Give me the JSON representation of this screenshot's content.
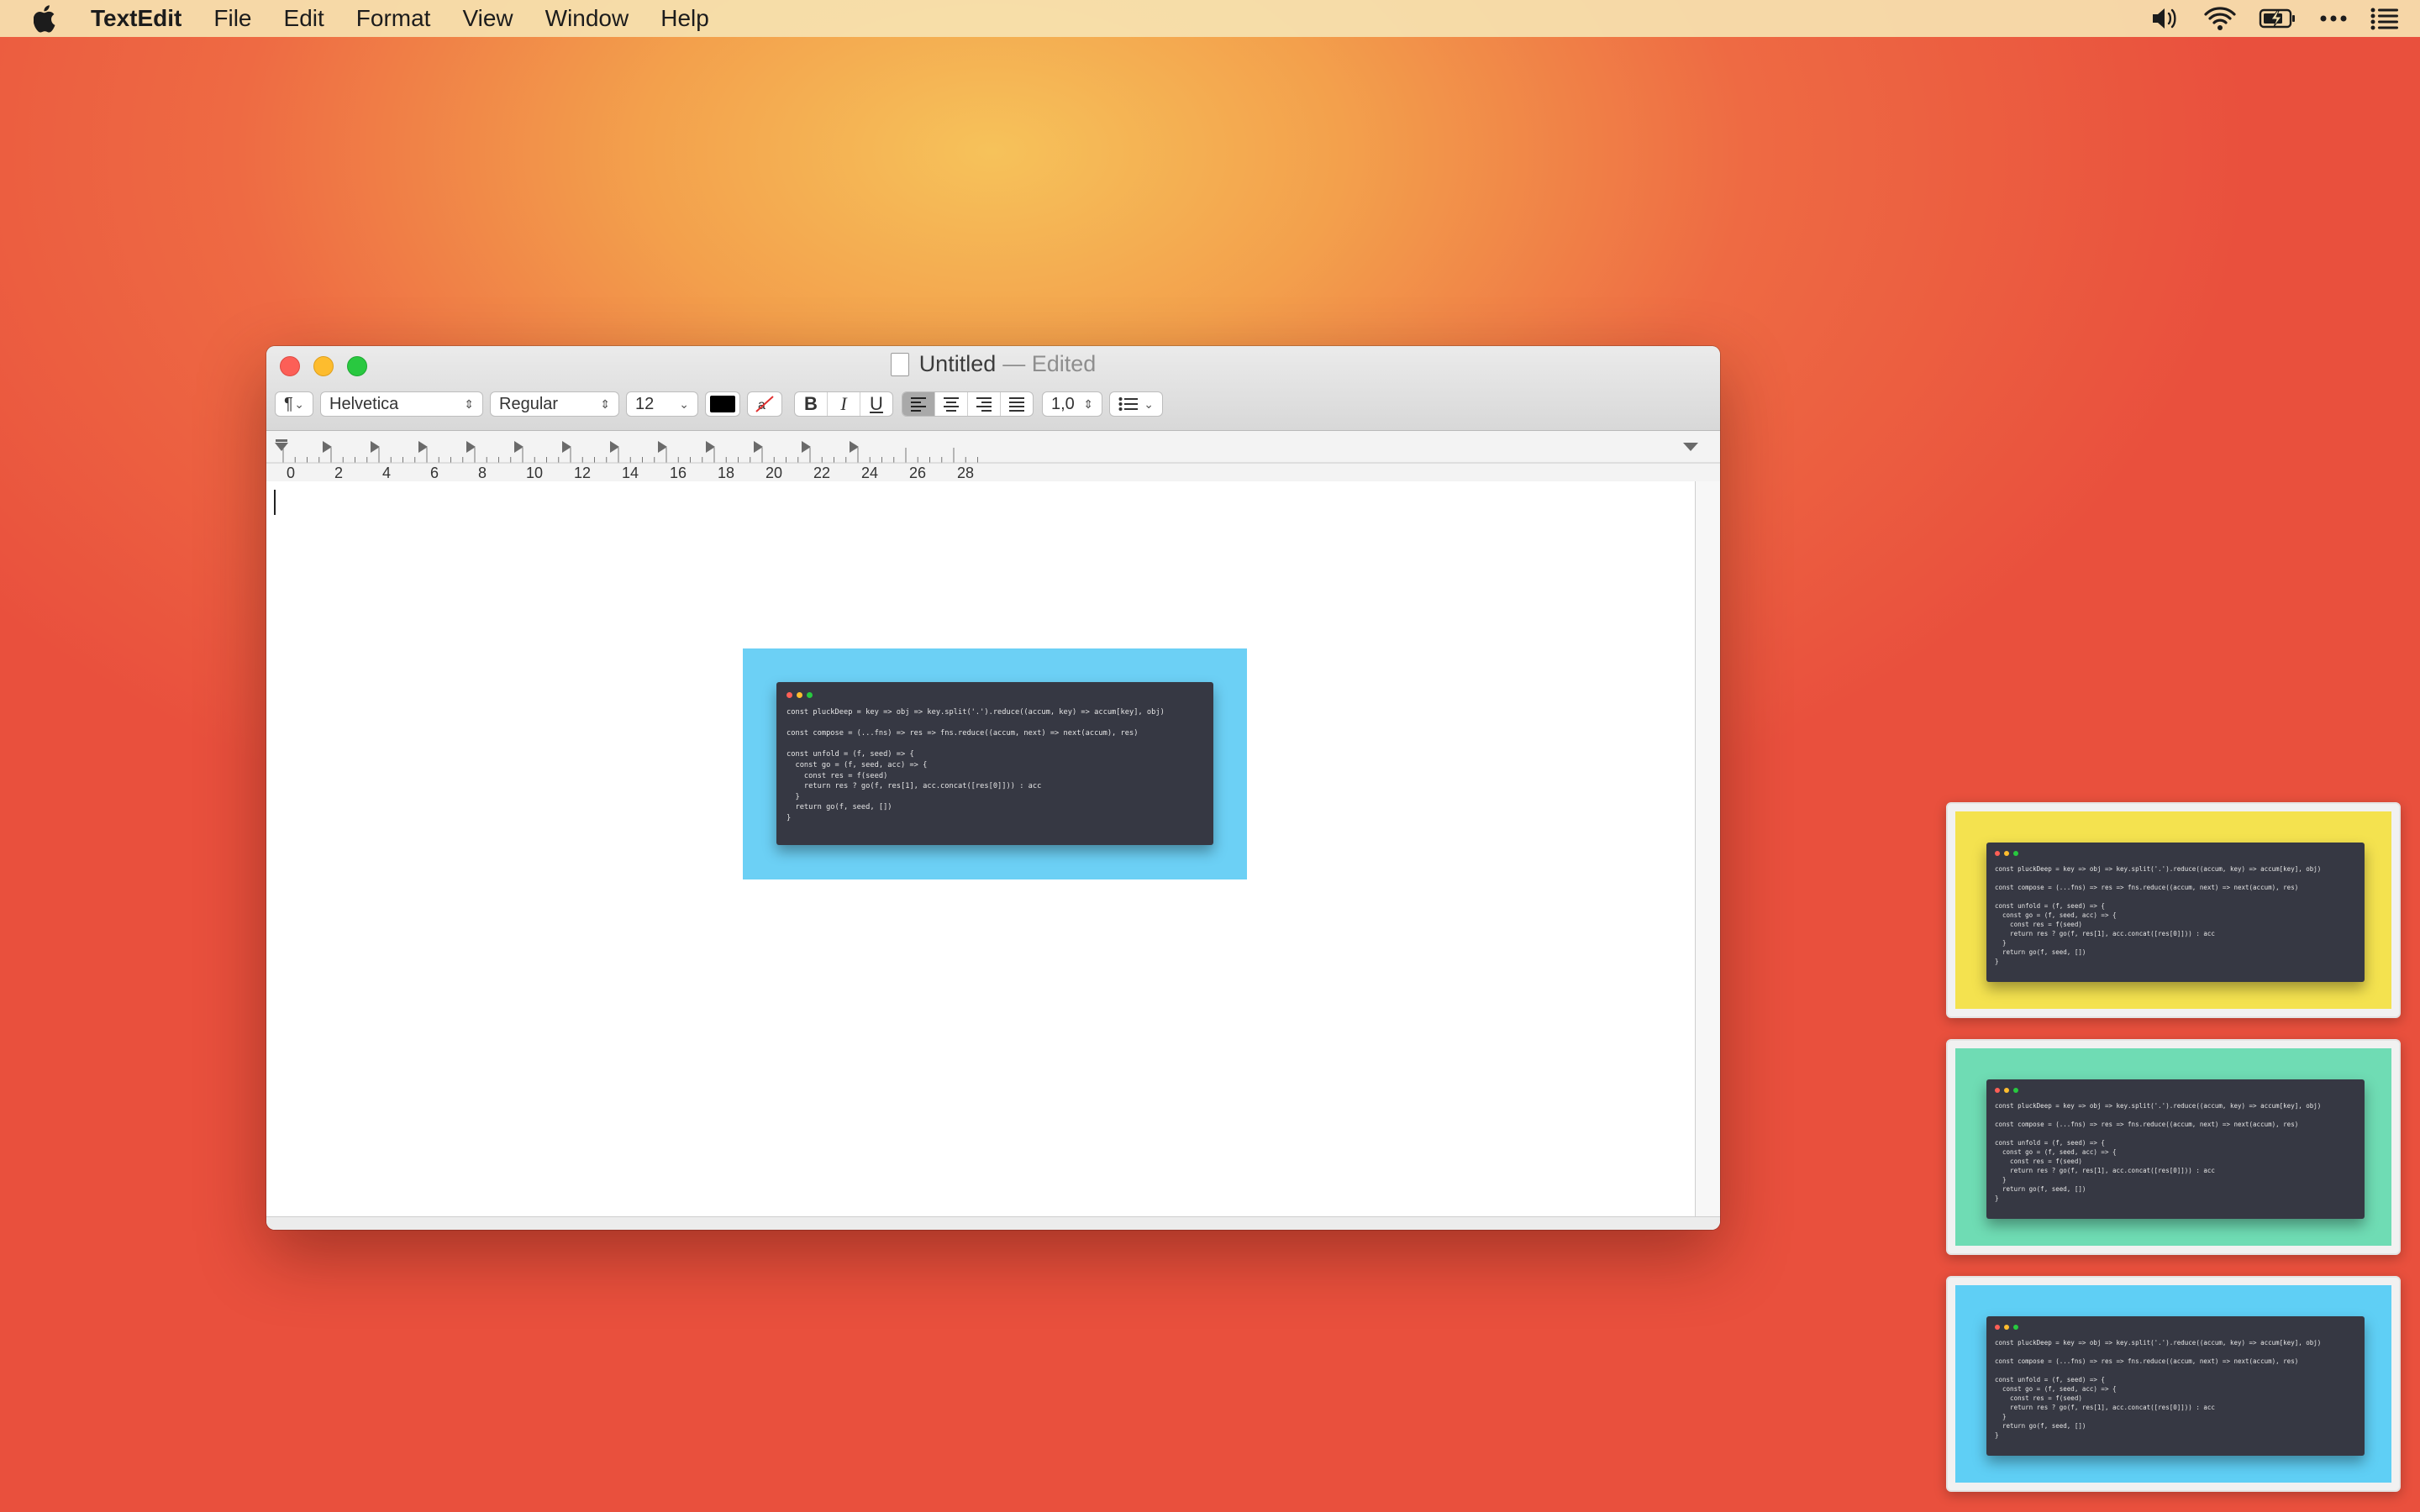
{
  "menubar": {
    "app_name": "TextEdit",
    "items": [
      "File",
      "Edit",
      "Format",
      "View",
      "Window",
      "Help"
    ],
    "status_icons": [
      "volume-icon",
      "wifi-icon",
      "battery-charging-icon",
      "more-icon",
      "control-center-icon"
    ]
  },
  "window": {
    "title": "Untitled",
    "edited_suffix": "— Edited",
    "toolbar": {
      "paragraph_style": "¶",
      "font_family": "Helvetica",
      "font_style": "Regular",
      "font_size": "12",
      "bold": "B",
      "italic": "I",
      "underline": "U",
      "line_spacing": "1,0",
      "list_icon": "list-bullets-icon",
      "text_color": "#000000"
    },
    "ruler": {
      "labels": [
        "0",
        "2",
        "4",
        "6",
        "8",
        "10",
        "12",
        "14",
        "16",
        "18",
        "20",
        "22",
        "24",
        "26",
        "28"
      ]
    }
  },
  "code_snippet": {
    "lines": [
      "const pluckDeep = key => obj => key.split('.').reduce((accum, key) => accum[key], obj)",
      "",
      "const compose = (...fns) => res => fns.reduce((accum, next) => next(accum), res)",
      "",
      "const unfold = (f, seed) => {",
      "  const go = (f, seed, acc) => {",
      "    const res = f(seed)",
      "    return res ? go(f, res[1], acc.concat([res[0]])) : acc",
      "  }",
      "  return go(f, seed, [])",
      "}"
    ]
  },
  "colors": {
    "doc_card_background": "#6cd0f5",
    "thumbnail_backgrounds": [
      "#f4e24f",
      "#6fdcb4",
      "#5fcff5"
    ],
    "terminal": "#363843",
    "dot_red": "#ff5f56",
    "dot_yellow": "#ffbd2e",
    "dot_green": "#27c93f"
  }
}
